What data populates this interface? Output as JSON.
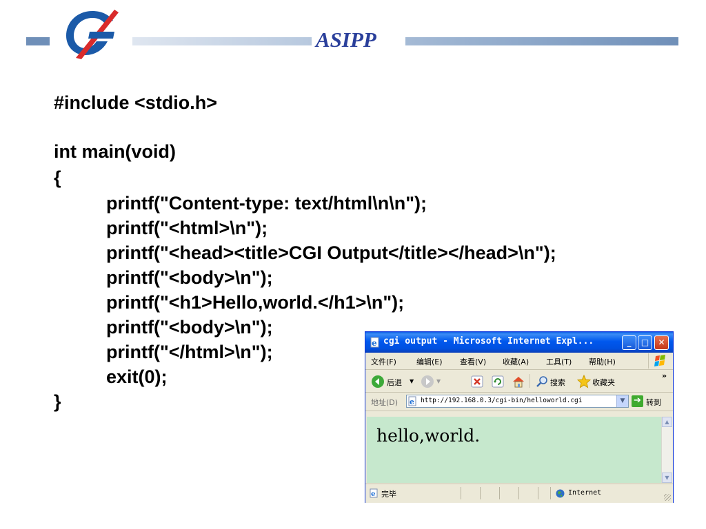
{
  "header": {
    "title": "ASIPP"
  },
  "code_lines": {
    "l1": "#include <stdio.h>",
    "l2": "int main(void)",
    "l3": "{",
    "l4": "printf(\"Content-type: text/html\\n\\n\");",
    "l5": "printf(\"<html>\\n\");",
    "l6": "printf(\"<head><title>CGI Output</title></head>\\n\");",
    "l7": "printf(\"<body>\\n\");",
    "l8": "printf(\"<h1>Hello,world.</h1>\\n\");",
    "l9": "printf(\"<body>\\n\");",
    "l10": "printf(\"</html>\\n\");",
    "l11": "exit(0);",
    "l12": "}"
  },
  "browser": {
    "title": "cgi output - Microsoft Internet Expl...",
    "window_buttons": {
      "minimize": "_",
      "maximize": "□",
      "close": "✕"
    },
    "menu": [
      "文件(F)",
      "编辑(E)",
      "查看(V)",
      "收藏(A)",
      "工具(T)",
      "帮助(H)"
    ],
    "toolbar": {
      "back": "后退",
      "search": "搜索",
      "favorites": "收藏夹",
      "more": "»"
    },
    "address": {
      "label": "地址(D)",
      "url": "http://192.168.0.3/cgi-bin/helloworld.cgi",
      "go_label": "转到"
    },
    "content": "hello,world.",
    "status": {
      "text": "完毕",
      "zone": "Internet"
    }
  },
  "icons": {
    "logo": "asipp-logo",
    "ie_page": "ie-page-icon",
    "back": "back-arrow-icon",
    "forward": "forward-arrow-icon",
    "stop": "stop-icon",
    "refresh": "refresh-icon",
    "home": "home-icon",
    "search": "search-icon",
    "favorites": "star-icon",
    "go": "go-arrow-icon",
    "globe": "globe-icon",
    "windows_logo": "windows-logo-icon"
  },
  "colors": {
    "title_text": "#2a3f9b",
    "header_bar": "#6f8fb8",
    "browser_content_bg": "#c6e8cd",
    "ie_title_blue": "#0058ee"
  }
}
